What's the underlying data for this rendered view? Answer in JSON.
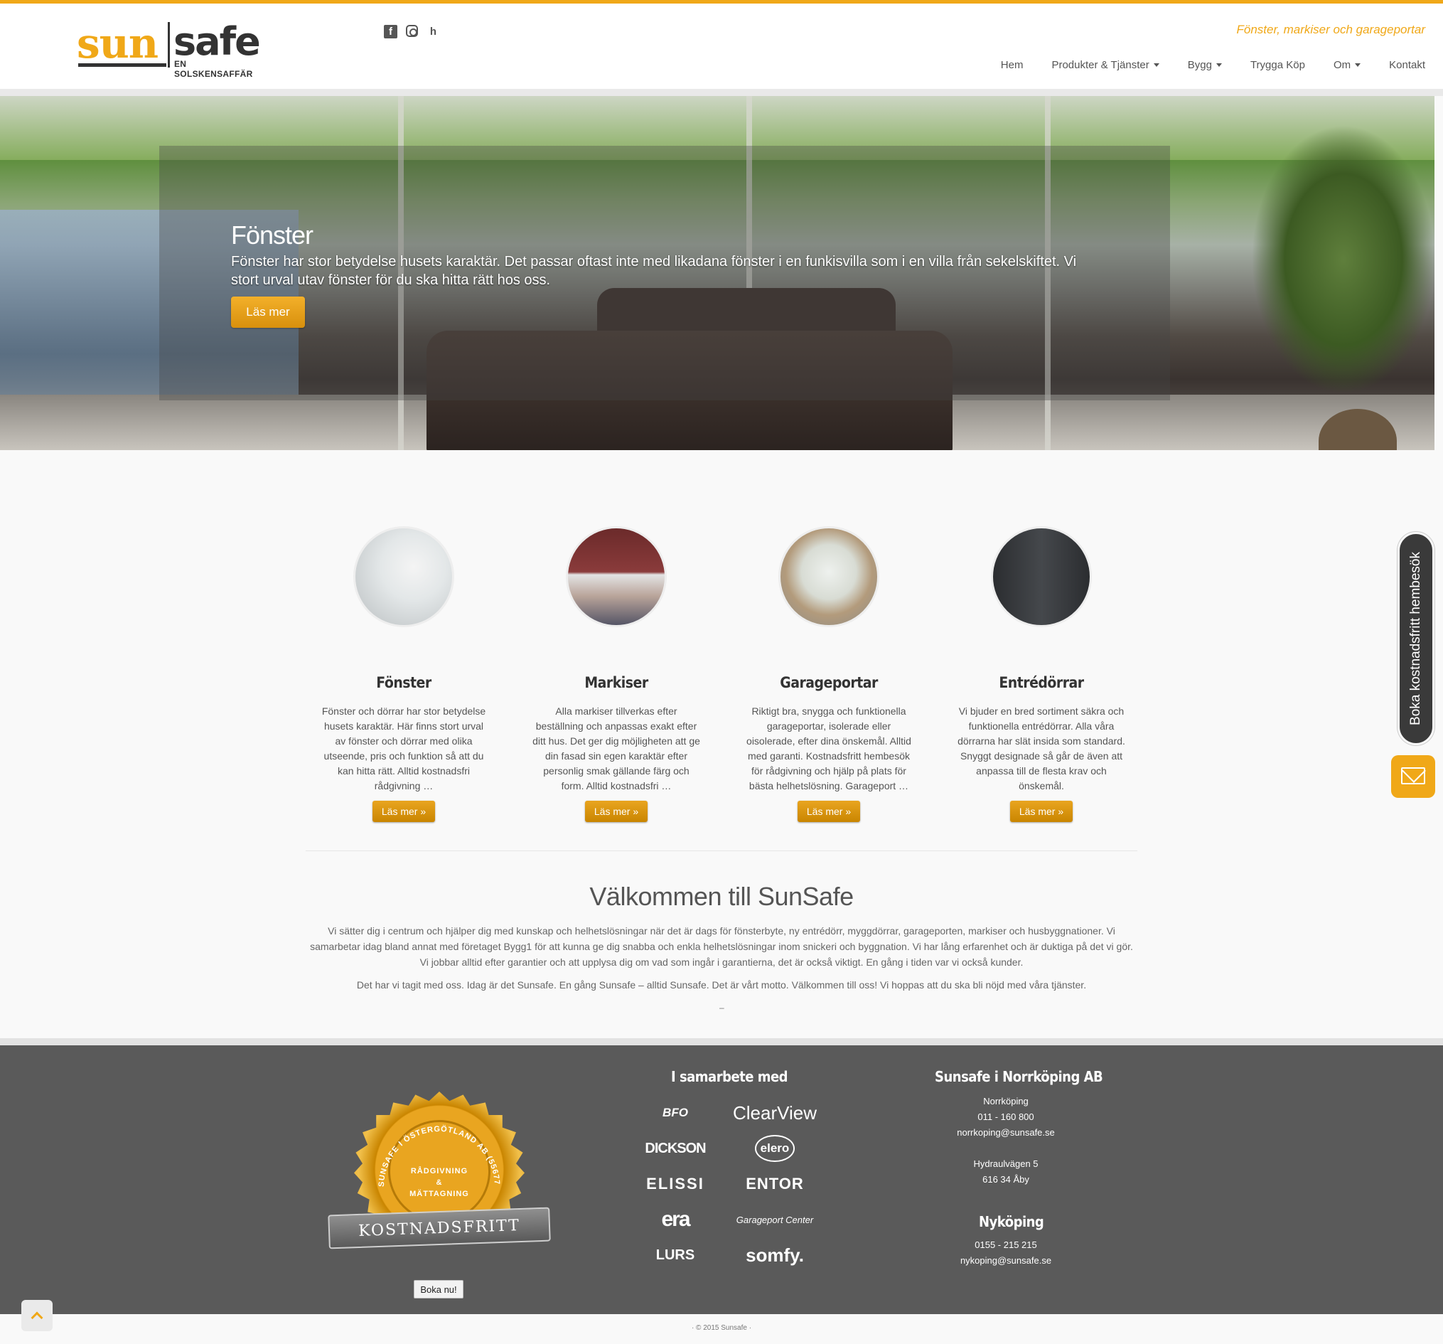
{
  "brand": {
    "logo_sun": "sun",
    "logo_safe": "safe",
    "logo_tagline": "EN SOLSKENSAFFÄR",
    "tagline": "Fönster, markiser och garageportar",
    "accent_color": "#f0a818"
  },
  "social": [
    {
      "icon": "facebook-icon",
      "glyph": "f"
    },
    {
      "icon": "instagram-icon",
      "glyph": ""
    },
    {
      "icon": "houzz-icon",
      "glyph": "h"
    }
  ],
  "nav": {
    "items": [
      {
        "label": "Hem",
        "dropdown": false
      },
      {
        "label": "Produkter & Tjänster",
        "dropdown": true
      },
      {
        "label": "Bygg",
        "dropdown": true
      },
      {
        "label": "Trygga Köp",
        "dropdown": false
      },
      {
        "label": "Om",
        "dropdown": true
      },
      {
        "label": "Kontakt",
        "dropdown": false
      }
    ]
  },
  "hero": {
    "title": "Fönster",
    "text": "Fönster har stor betydelse husets karaktär. Det passar oftast inte med likadana fönster i en funkisvilla som i en villa från sekelskiftet. Vi stort urval utav fönster för du ska hitta rätt hos oss.",
    "button": "Läs mer"
  },
  "features": [
    {
      "title": "Fönster",
      "text": "Fönster och dörrar har stor betydelse husets karaktär. Här finns stort urval av fönster och dörrar med olika utseende, pris och funktion så att du kan hitta rätt. Alltid kostnadsfri rådgivning …",
      "button": "Läs mer »"
    },
    {
      "title": "Markiser",
      "text": "Alla markiser tillverkas efter beställning och anpassas exakt efter ditt hus. Det ger dig möjligheten att ge din fasad sin egen karaktär efter personlig smak gällande färg och form. Alltid kostnadsfri …",
      "button": "Läs mer »"
    },
    {
      "title": "Garageportar",
      "text": "Riktigt bra, snygga och funktionella garageportar, isolerade eller oisolerade, efter dina önskemål. Alltid med garanti. Kostnadsfritt hembesök för rådgivning och hjälp på plats för bästa helhetslösning. Garageport …",
      "button": "Läs mer »"
    },
    {
      "title": "Entrédörrar",
      "text": "Vi bjuder en bred sortiment säkra och funktionella entrédörrar. Alla våra dörrarna har slät insida som standard. Snyggt designade så går de även att anpassa till de flesta krav och önskemål.",
      "button": "Läs mer »"
    }
  ],
  "welcome": {
    "title": "Välkommen till SunSafe",
    "p1": "Vi sätter dig i centrum och hjälper dig med kunskap och helhetslösningar när det är dags för fönsterbyte, ny entrédörr, myggdörrar, garageporten, markiser och husbyggnationer. Vi samarbetar idag bland annat med företaget Bygg1  för att kunna ge dig snabba och enkla helhetslösningar inom snickeri och byggnation. Vi har lång erfarenhet och är duktiga på det vi gör. Vi jobbar alltid efter garantier och att upplysa dig om vad som ingår i garantierna, det är också viktigt. En gång i tiden var vi också kunder.",
    "p2": "Det har vi tagit med oss. Idag är det Sunsafe. En gång Sunsafe – alltid Sunsafe.  Det är vårt motto. Välkommen till oss! Vi hoppas att du ska bli nöjd med våra tjänster.",
    "dash": "–"
  },
  "side_widget": {
    "tab_label": "Boka kostnadsfritt hembesök",
    "mail_icon": "envelope-icon"
  },
  "badge": {
    "arc_text": "SUNSAFE I ÖSTERGÖTLAND AB (556774-7273)",
    "line1": "RÅDGIVNING",
    "line2": "&",
    "line3": "MÄTTAGNING",
    "ribbon": "KOSTNADSFRITT",
    "button": "Boka nu!"
  },
  "footer": {
    "partners_title": "I samarbete med",
    "partners": [
      "BFO",
      "ClearView",
      "DICKSON",
      "elero",
      "ELISSI",
      "ENTOR",
      "era",
      "Garageport Center",
      "LURS",
      "somfy."
    ],
    "company_title": "Sunsafe i Norrköping AB",
    "norrkoping": {
      "city": "Norrköping",
      "phone": "011 - 160 800",
      "email": "norrkoping@sunsafe.se",
      "street": "Hydraulvägen 5",
      "postal": "616 34 Åby"
    },
    "nykoping": {
      "title": "Nyköping",
      "phone": "0155 - 215 215",
      "email": "nykoping@sunsafe.se"
    },
    "copyright": "· © 2015 Sunsafe ·"
  }
}
